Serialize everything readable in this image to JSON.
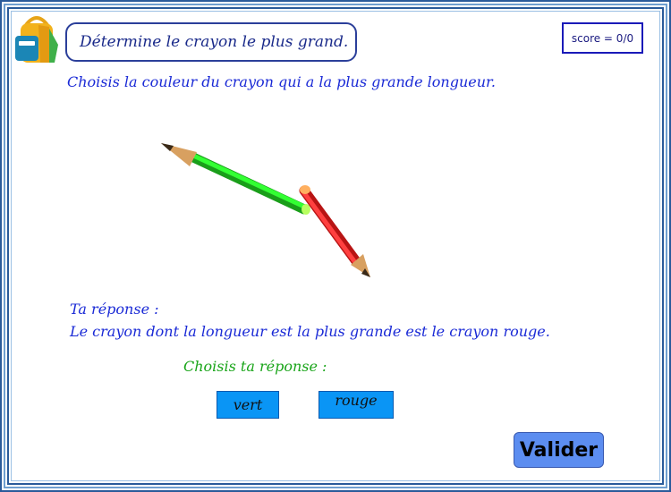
{
  "header": {
    "instruction": "Détermine le crayon le plus grand.",
    "score": "score = 0/0"
  },
  "question": "Choisis la couleur du crayon qui a la plus grande longueur.",
  "pencils": [
    {
      "color_name": "vert",
      "color": "#22cc22"
    },
    {
      "color_name": "rouge",
      "color": "#ee2222"
    }
  ],
  "answer": {
    "label": "Ta réponse :",
    "text": "Le crayon dont la longueur est la plus grande est le crayon rouge."
  },
  "choice": {
    "label": "Choisis ta réponse :",
    "options": [
      "vert",
      "rouge"
    ]
  },
  "validate_label": "Valider",
  "colors": {
    "border_dark": "#2a5a9a",
    "border_light": "#6f9fd0",
    "text_blue": "#1a2ad6",
    "text_green": "#1aa51a",
    "choice_button": "#0a95f5",
    "validate_button": "#5c8df0"
  }
}
